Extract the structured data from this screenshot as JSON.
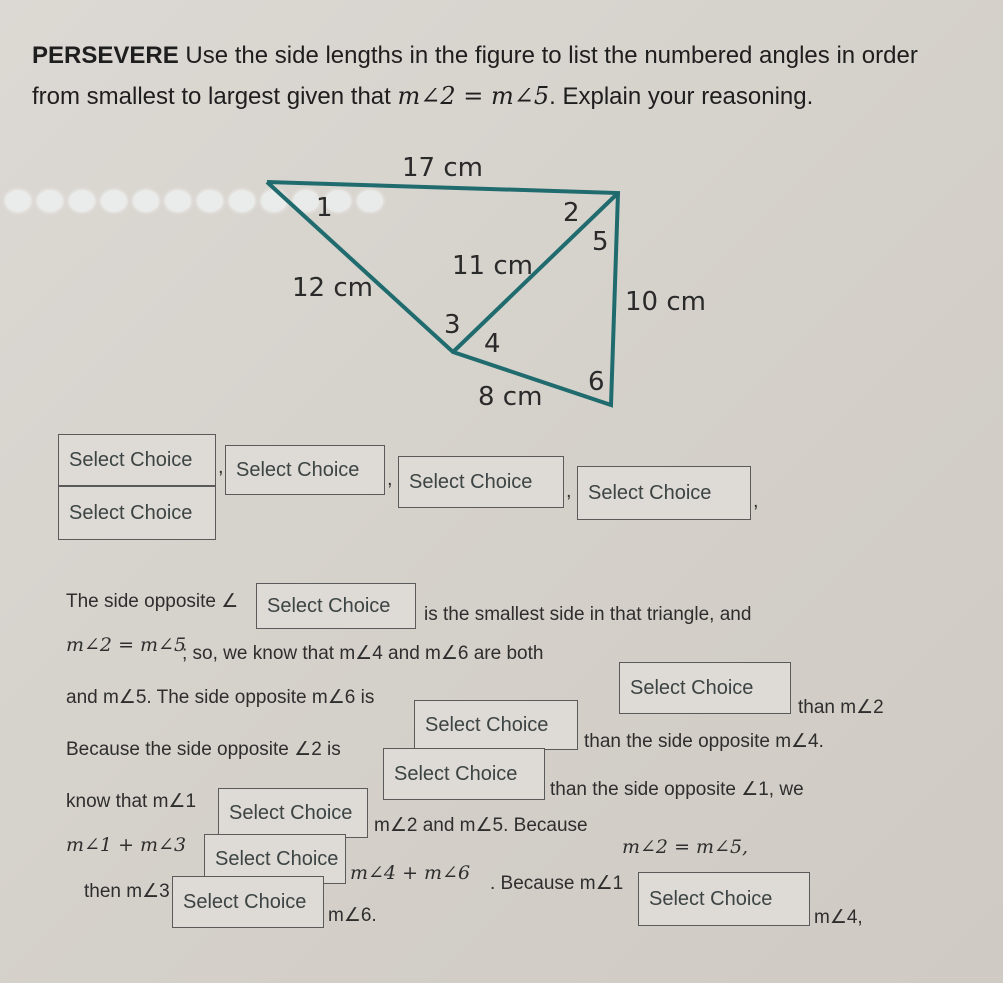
{
  "question": {
    "label": "PERSEVERE",
    "line1": "Use the side lengths in the figure to list the numbered angles in order",
    "line2_prefix": "from smallest to largest given that",
    "line2_math": "m∠2 = m∠5",
    "line2_suffix": ". Explain your reasoning."
  },
  "figure": {
    "color": "#1f6b6e",
    "sides": {
      "top": "17 cm",
      "left": "12 cm",
      "diagonal": "11 cm",
      "right": "10 cm",
      "bottom": "8 cm"
    },
    "angle_labels": [
      "1",
      "2",
      "3",
      "4",
      "5",
      "6"
    ]
  },
  "loading_indicator": {
    "dot_count": 12
  },
  "ordering": {
    "select_placeholder": "Select Choice",
    "slots": [
      "Select Choice",
      "Select Choice",
      "Select Choice",
      "Select Choice",
      "Select Choice",
      "Select Choice"
    ],
    "separator": ","
  },
  "explanation": {
    "t1": "The side opposite ∠",
    "t2": "is the smallest side in that triangle, and",
    "t3_math": "m∠2 = m∠5",
    "t3": "; so, we know that m∠4 and m∠6 are both",
    "t4": "than m∠2",
    "t5": "and m∠5. The side opposite m∠6 is",
    "t6": "than the side opposite m∠4.",
    "t7": "Because the side opposite ∠2 is",
    "t8": "than the side opposite ∠1, we",
    "t9": "know that m∠1",
    "t10": "m∠2 and m∠5. Because",
    "t10_math": "m∠2 = m∠5,",
    "t11_math": "m∠1 + m∠3",
    "t12_math": "m∠4 + m∠6",
    "t12": ". Because m∠1",
    "t13": "m∠4,",
    "t14": "then m∠3",
    "t15": "m∠6."
  }
}
